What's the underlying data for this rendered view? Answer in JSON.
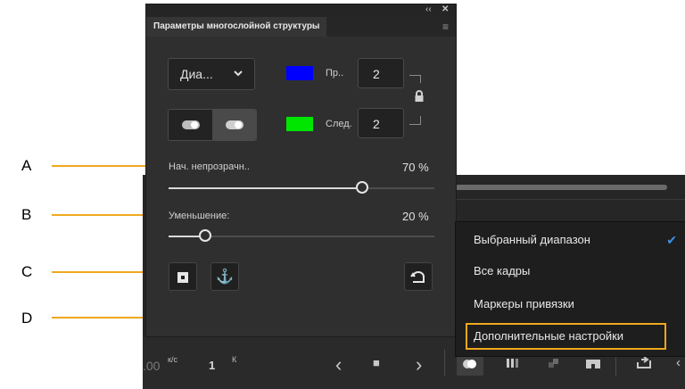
{
  "panel": {
    "title": "Параметры многослойной структуры",
    "collapse_glyph": "‹‹",
    "close_glyph": "✕",
    "menu_glyph": "≡",
    "range_dropdown": {
      "label": "Диа...",
      "chevron": "⌄"
    },
    "prev": {
      "label": "Пр..",
      "value": "2",
      "color": "#0000ff"
    },
    "next": {
      "label": "След.",
      "value": "2",
      "color": "#00e600"
    },
    "lock_glyph": "🔒",
    "start_opacity": {
      "label": "Нач. непрозрачн..",
      "value": "70 %",
      "level_percent": 70
    },
    "falloff": {
      "label": "Уменьшение:",
      "value": "20 %",
      "level_percent": 20
    },
    "icons": {
      "toggle_off": "toggle-off-icon",
      "toggle_on": "toggle-on-icon",
      "marker_button": "marker-square-icon",
      "anchor_button": "anchor-icon",
      "reset_button": "reset-icon"
    }
  },
  "glyphs": {
    "anchor": "⚓",
    "marker": "■",
    "reset": "↶"
  },
  "callouts": {
    "a": "A",
    "b": "B",
    "c": "C",
    "d": "D"
  },
  "popup_menu": {
    "items": [
      {
        "label": "Выбранный диапазон",
        "checked": true
      },
      {
        "label": "Все кадры",
        "checked": false
      },
      {
        "label": "Маркеры привязки",
        "checked": false
      },
      {
        "label": "Дополнительные настройки",
        "checked": false,
        "highlighted": true
      }
    ],
    "check_glyph": "✔",
    "accent_color": "#3b91e8",
    "highlight_color": "#f0a81e"
  },
  "bottom_bar": {
    "fps_value": ".00",
    "fps_unit": "к/с",
    "frame_value": "1",
    "frame_unit": "К",
    "nav": {
      "prev": "‹",
      "marker": "■",
      "next": "›"
    },
    "tools": [
      "onion-skin-icon",
      "onion-outline-icon",
      "edit-multiple-icon",
      "center-frame-icon",
      "loop-icon"
    ]
  }
}
